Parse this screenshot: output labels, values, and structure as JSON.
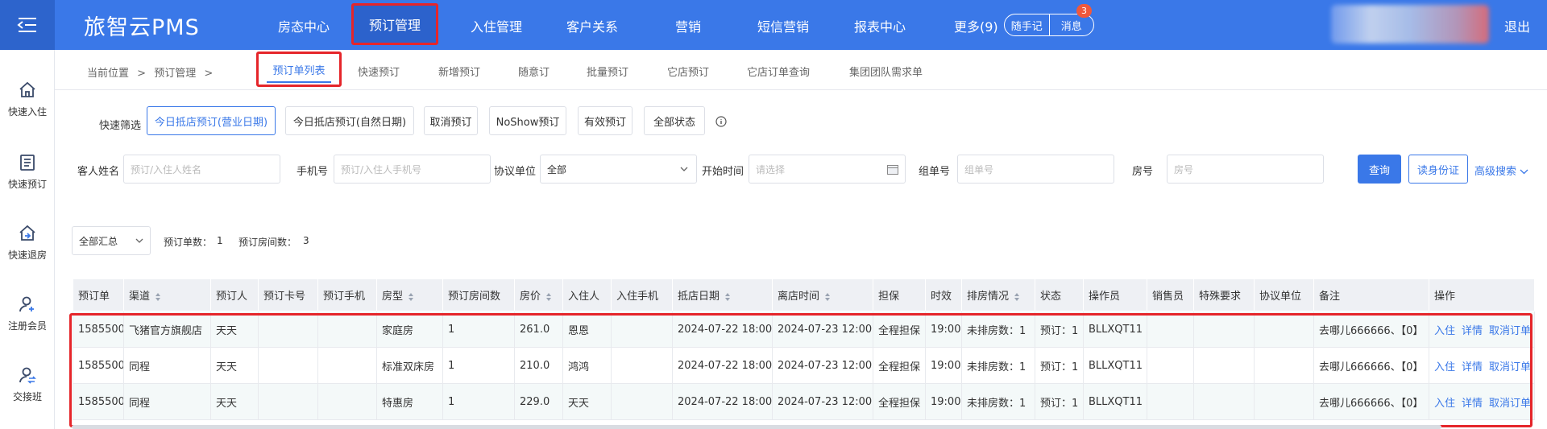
{
  "app": {
    "logo": "旅智云PMS",
    "logout": "退出",
    "badge_count": "3",
    "quick_note": "随手记",
    "messages": "消息"
  },
  "topnav": [
    "房态中心",
    "预订管理",
    "入住管理",
    "客户关系",
    "营销",
    "短信营销",
    "报表中心",
    "更多(9)"
  ],
  "sidebar": [
    "快速入住",
    "快速预订",
    "快速退房",
    "注册会员",
    "交接班"
  ],
  "breadcrumb": {
    "label": "当前位置",
    "sep": ">",
    "current": "预订管理",
    "sep2": ">"
  },
  "subtabs": [
    "预订单列表",
    "快速预订",
    "新增预订",
    "随意订",
    "批量预订",
    "它店预订",
    "它店订单查询",
    "集团团队需求单"
  ],
  "quick_filter": {
    "label": "快速筛选",
    "buttons": [
      "今日抵店预订(营业日期)",
      "今日抵店预订(自然日期)",
      "取消预订",
      "NoShow预订",
      "有效预订",
      "全部状态"
    ]
  },
  "filters": {
    "guest_name": {
      "label": "客人姓名",
      "placeholder": "预订/入住人姓名"
    },
    "phone": {
      "label": "手机号",
      "placeholder": "预订/入住人手机号"
    },
    "agreement": {
      "label": "协议单位",
      "value": "全部"
    },
    "start_time": {
      "label": "开始时间",
      "placeholder": "请选择"
    },
    "group_no": {
      "label": "组单号",
      "placeholder": "组单号"
    },
    "room_no": {
      "label": "房号",
      "placeholder": "房号"
    },
    "query": "查询",
    "read_id": "读身份证",
    "advanced": "高级搜索"
  },
  "summary": {
    "select": "全部汇总",
    "order_count_label": "预订单数：",
    "order_count": "1",
    "room_count_label": "预订房间数：",
    "room_count": "3"
  },
  "table": {
    "headers": [
      "预订单",
      "渠道",
      "预订人",
      "预订卡号",
      "预订手机",
      "房型",
      "预订房间数",
      "房价",
      "入住人",
      "入住手机",
      "抵店日期",
      "离店时间",
      "担保",
      "时效",
      "排房情况",
      "状态",
      "操作员",
      "销售员",
      "特殊要求",
      "协议单位",
      "备注",
      "操作"
    ],
    "rows": [
      [
        "1585500",
        "飞猪官方旗舰店",
        "天天",
        "",
        "",
        "家庭房",
        "1",
        "261.0",
        "恩恩",
        "",
        "2024-07-22 18:00",
        "2024-07-23 12:00",
        "全程担保",
        "19:00",
        "未排房数：1",
        "预订：1",
        "BLLXQT11",
        "",
        "",
        "",
        "去哪儿666666、【0】"
      ],
      [
        "1585500",
        "同程",
        "天天",
        "",
        "",
        "标准双床房",
        "1",
        "210.0",
        "鸿鸿",
        "",
        "2024-07-22 18:00",
        "2024-07-23 12:00",
        "全程担保",
        "19:00",
        "未排房数：1",
        "预订：1",
        "BLLXQT11",
        "",
        "",
        "",
        "去哪儿666666、【0】"
      ],
      [
        "1585500",
        "同程",
        "天天",
        "",
        "",
        "特惠房",
        "1",
        "229.0",
        "天天",
        "",
        "2024-07-22 18:00",
        "2024-07-23 12:00",
        "全程担保",
        "19:00",
        "未排房数：1",
        "预订：1",
        "BLLXQT11",
        "",
        "",
        "",
        "去哪儿666666、【0】"
      ]
    ],
    "actions": [
      "入住",
      "详情",
      "取消订单"
    ]
  },
  "colors": {
    "primary": "#3a78e8",
    "topbar": "#3a78e8",
    "highlight": "#e5252a"
  }
}
